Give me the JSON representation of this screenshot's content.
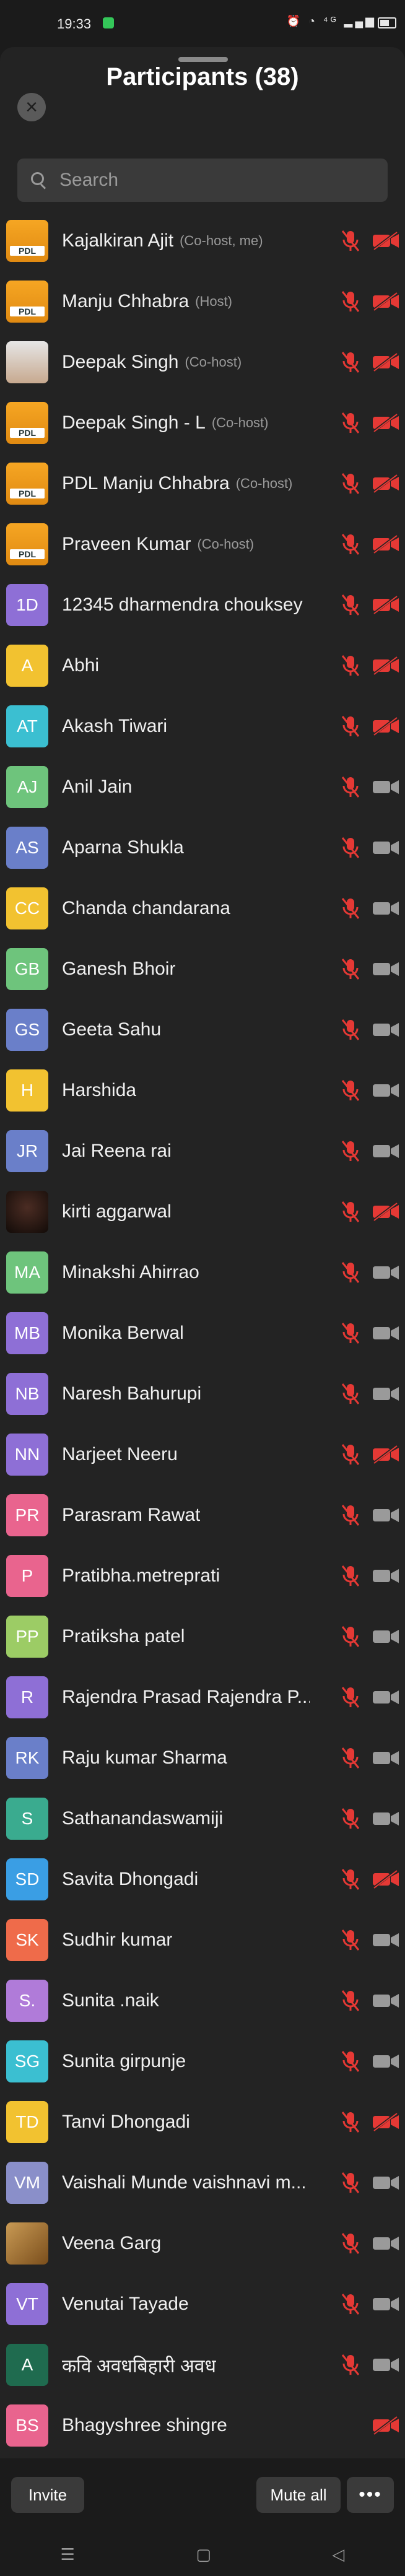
{
  "status": {
    "time": "19:33",
    "icons": "⏰ ◔ ⁴ᴳ ▂▄▆"
  },
  "header": {
    "title": "Participants (38)"
  },
  "search": {
    "placeholder": "Search"
  },
  "participants": [
    {
      "name": "Kajalkiran Ajit",
      "role": "(Co-host, me)",
      "avatar": "pdl",
      "initials": "",
      "mic": "off",
      "cam": "off"
    },
    {
      "name": "Manju Chhabra",
      "role": "(Host)",
      "avatar": "pdl",
      "initials": "",
      "mic": "off",
      "cam": "off"
    },
    {
      "name": "Deepak Singh",
      "role": "(Co-host)",
      "avatar": "photo",
      "initials": "",
      "mic": "off",
      "cam": "off"
    },
    {
      "name": "Deepak Singh - L",
      "role": "(Co-host)",
      "avatar": "pdl",
      "initials": "",
      "mic": "off",
      "cam": "off"
    },
    {
      "name": "PDL Manju Chhabra",
      "role": "(Co-host)",
      "avatar": "pdl",
      "initials": "",
      "mic": "off",
      "cam": "off"
    },
    {
      "name": "Praveen Kumar",
      "role": "(Co-host)",
      "avatar": "pdl",
      "initials": "",
      "mic": "off",
      "cam": "off"
    },
    {
      "name": "12345 dharmendra chouksey",
      "role": "",
      "avatar": "#8e6fd6",
      "initials": "1D",
      "mic": "off",
      "cam": "off"
    },
    {
      "name": "Abhi",
      "role": "",
      "avatar": "#f2c230",
      "initials": "A",
      "mic": "off",
      "cam": "off"
    },
    {
      "name": "Akash Tiwari",
      "role": "",
      "avatar": "#3bbfd1",
      "initials": "AT",
      "mic": "off",
      "cam": "off"
    },
    {
      "name": "Anil Jain",
      "role": "",
      "avatar": "#6ec47c",
      "initials": "AJ",
      "mic": "off",
      "cam": "gray"
    },
    {
      "name": "Aparna Shukla",
      "role": "",
      "avatar": "#6a7fc9",
      "initials": "AS",
      "mic": "off",
      "cam": "gray"
    },
    {
      "name": "Chanda chandarana",
      "role": "",
      "avatar": "#f2c230",
      "initials": "CC",
      "mic": "off",
      "cam": "gray"
    },
    {
      "name": "Ganesh Bhoir",
      "role": "",
      "avatar": "#6ec47c",
      "initials": "GB",
      "mic": "off",
      "cam": "gray"
    },
    {
      "name": "Geeta Sahu",
      "role": "",
      "avatar": "#6a7fc9",
      "initials": "GS",
      "mic": "off",
      "cam": "gray"
    },
    {
      "name": "Harshida",
      "role": "",
      "avatar": "#f2c230",
      "initials": "H",
      "mic": "off",
      "cam": "gray"
    },
    {
      "name": "Jai Reena rai",
      "role": "",
      "avatar": "#6a7fc9",
      "initials": "JR",
      "mic": "off",
      "cam": "gray"
    },
    {
      "name": "kirti aggarwal",
      "role": "",
      "avatar": "photo2",
      "initials": "",
      "mic": "off",
      "cam": "off"
    },
    {
      "name": "Minakshi Ahirrao",
      "role": "",
      "avatar": "#6ec47c",
      "initials": "MA",
      "mic": "off",
      "cam": "gray"
    },
    {
      "name": "Monika Berwal",
      "role": "",
      "avatar": "#8e6fd6",
      "initials": "MB",
      "mic": "off",
      "cam": "gray"
    },
    {
      "name": "Naresh Bahurupi",
      "role": "",
      "avatar": "#8e6fd6",
      "initials": "NB",
      "mic": "off",
      "cam": "gray"
    },
    {
      "name": "Narjeet Neeru",
      "role": "",
      "avatar": "#8e6fd6",
      "initials": "NN",
      "mic": "off",
      "cam": "off"
    },
    {
      "name": "Parasram Rawat",
      "role": "",
      "avatar": "#e9648e",
      "initials": "PR",
      "mic": "off",
      "cam": "gray"
    },
    {
      "name": "Pratibha.metreprati",
      "role": "",
      "avatar": "#e9648e",
      "initials": "P",
      "mic": "off",
      "cam": "gray"
    },
    {
      "name": "Pratiksha patel",
      "role": "",
      "avatar": "#9ccc65",
      "initials": "PP",
      "mic": "off",
      "cam": "gray"
    },
    {
      "name": "Rajendra  Prasad Rajendra P...",
      "role": "",
      "avatar": "#8e6fd6",
      "initials": "R",
      "mic": "off",
      "cam": "gray"
    },
    {
      "name": "Raju kumar Sharma",
      "role": "",
      "avatar": "#6a7fc9",
      "initials": "RK",
      "mic": "off",
      "cam": "gray"
    },
    {
      "name": "Sathanandaswamiji",
      "role": "",
      "avatar": "#3aab8f",
      "initials": "S",
      "mic": "off",
      "cam": "gray"
    },
    {
      "name": "Savita Dhongadi",
      "role": "",
      "avatar": "#3a9ee4",
      "initials": "SD",
      "mic": "off",
      "cam": "off"
    },
    {
      "name": "Sudhir kumar",
      "role": "",
      "avatar": "#ef6b4a",
      "initials": "SK",
      "mic": "off",
      "cam": "gray"
    },
    {
      "name": "Sunita .naik",
      "role": "",
      "avatar": "#b07bd9",
      "initials": "S.",
      "mic": "off",
      "cam": "gray"
    },
    {
      "name": "Sunita girpunje",
      "role": "",
      "avatar": "#3bbfd1",
      "initials": "SG",
      "mic": "off",
      "cam": "gray"
    },
    {
      "name": "Tanvi Dhongadi",
      "role": "",
      "avatar": "#f2c230",
      "initials": "TD",
      "mic": "off",
      "cam": "off"
    },
    {
      "name": "Vaishali Munde vaishnavi m...",
      "role": "",
      "avatar": "#8a8fc9",
      "initials": "VM",
      "mic": "off",
      "cam": "gray"
    },
    {
      "name": "Veena Garg",
      "role": "",
      "avatar": "photo3",
      "initials": "",
      "mic": "off",
      "cam": "gray"
    },
    {
      "name": "Venutai Tayade",
      "role": "",
      "avatar": "#8e6fd6",
      "initials": "VT",
      "mic": "off",
      "cam": "gray"
    },
    {
      "name": "कवि अवधबिहारी अवध",
      "role": "",
      "avatar": "#1f6b4f",
      "initials": "A",
      "mic": "off",
      "cam": "gray"
    },
    {
      "name": "Bhagyshree shingre",
      "role": "",
      "avatar": "#e9648e",
      "initials": "BS",
      "mic": "none",
      "cam": "off"
    }
  ],
  "footer": {
    "invite_label": "Invite",
    "mute_all_label": "Mute all",
    "more_label": "•••"
  },
  "navbar": {
    "menu": "☰",
    "home": "▢",
    "back": "◁"
  },
  "colors": {
    "red": "#e53935",
    "gray_icon": "#9a9a9a"
  }
}
